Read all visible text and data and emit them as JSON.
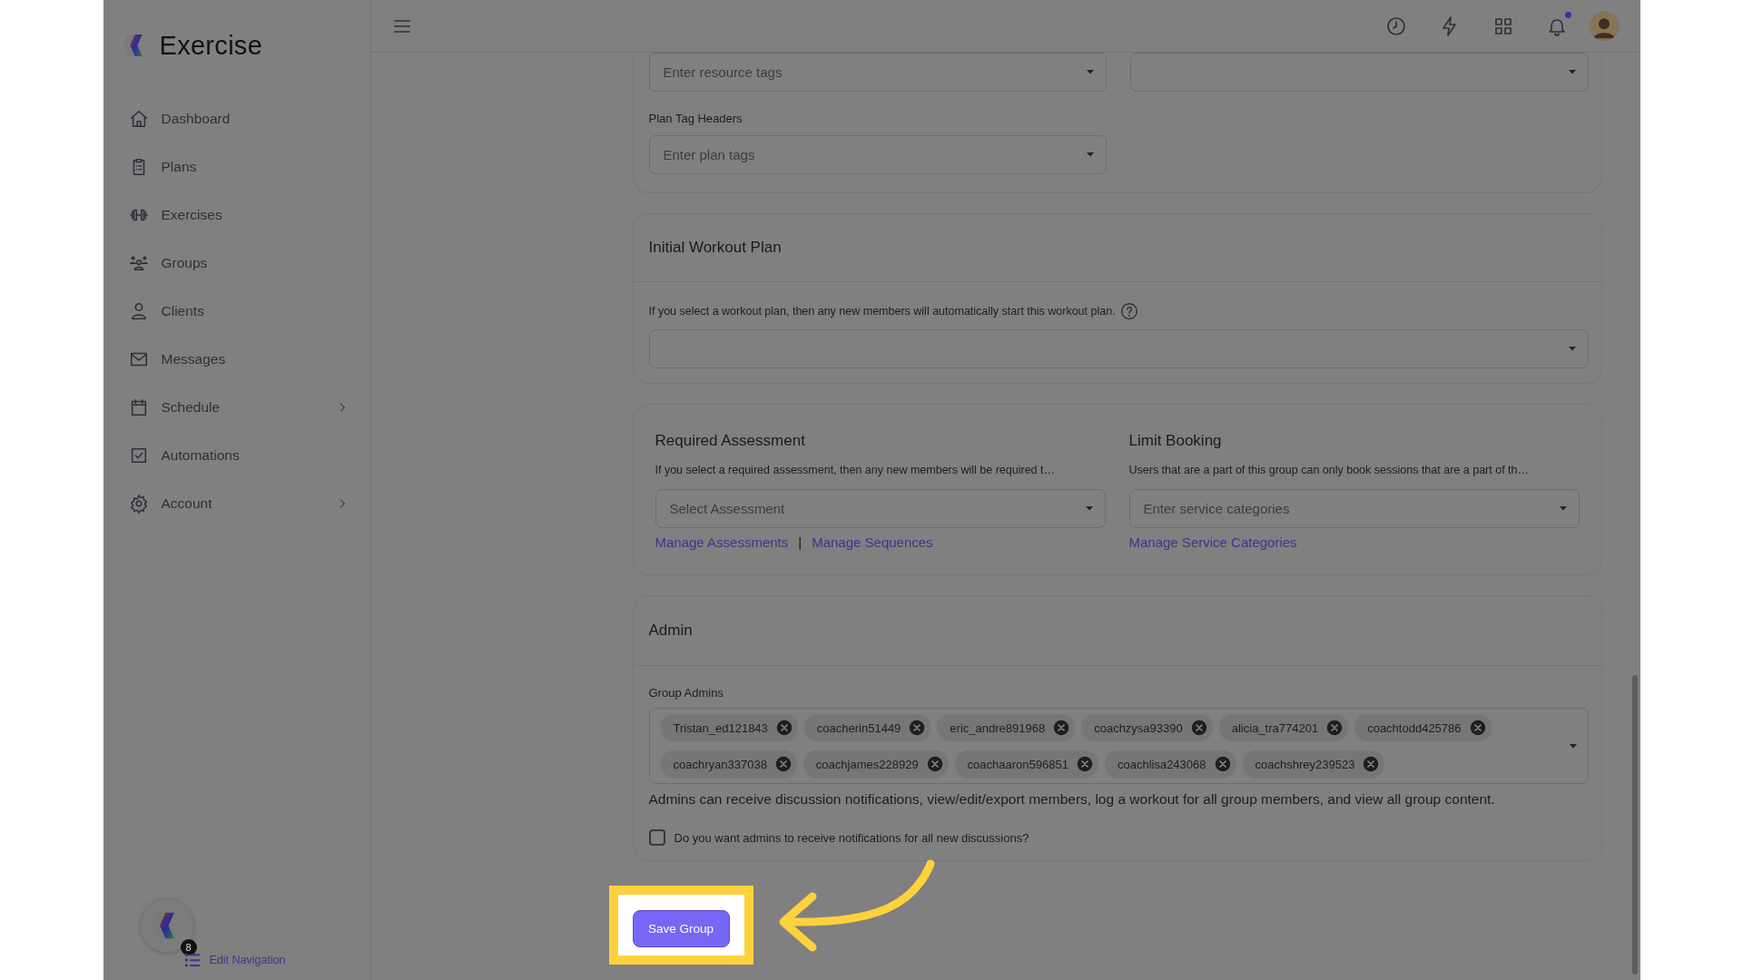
{
  "sidebar": {
    "brand": "Exercise",
    "items": [
      {
        "label": "Dashboard",
        "has_submenu": false
      },
      {
        "label": "Plans",
        "has_submenu": false
      },
      {
        "label": "Exercises",
        "has_submenu": false
      },
      {
        "label": "Groups",
        "has_submenu": false
      },
      {
        "label": "Clients",
        "has_submenu": false
      },
      {
        "label": "Messages",
        "has_submenu": false
      },
      {
        "label": "Schedule",
        "has_submenu": true
      },
      {
        "label": "Automations",
        "has_submenu": false
      },
      {
        "label": "Account",
        "has_submenu": true
      }
    ],
    "help_badge": "8",
    "edit_navigation": "Edit Navigation"
  },
  "topbar": {
    "notifications_unread": true
  },
  "resource_tags": {
    "placeholder": "Enter resource tags"
  },
  "plan_tag_headers": {
    "label": "Plan Tag Headers",
    "placeholder": "Enter plan tags"
  },
  "initial_workout_plan": {
    "title": "Initial Workout Plan",
    "description": "If you select a workout plan, then any new members will automatically start this workout plan."
  },
  "required_assessment": {
    "title": "Required Assessment",
    "description": "If you select a required assessment, then any new members will be required t…",
    "placeholder": "Select Assessment",
    "links": [
      "Manage Assessments",
      "Manage Sequences"
    ],
    "separator": "|"
  },
  "limit_booking": {
    "title": "Limit Booking",
    "description": "Users that are a part of this group can only book sessions that are a part of th…",
    "placeholder": "Enter service categories",
    "links": [
      "Manage Service Categories"
    ]
  },
  "admin": {
    "title": "Admin",
    "group_admins": {
      "label": "Group Admins",
      "tags": [
        "Tristan_ed121843",
        "coacherin51449",
        "eric_andre891968",
        "coachzysa93390",
        "alicia_tra774201",
        "coachtodd425786",
        "coachryan337038",
        "coachjames228929",
        "coachaaron596851",
        "coachlisa243068",
        "coachshrey239523"
      ]
    },
    "help": "Admins can receive discussion notifications, view/edit/export members, log a workout for all group members, and view all group content.",
    "notify_checkbox": {
      "label": "Do you want admins to receive notifications for all new discussions?",
      "checked": false
    }
  },
  "save_button": {
    "label": "Save Group",
    "highlighted": true
  }
}
